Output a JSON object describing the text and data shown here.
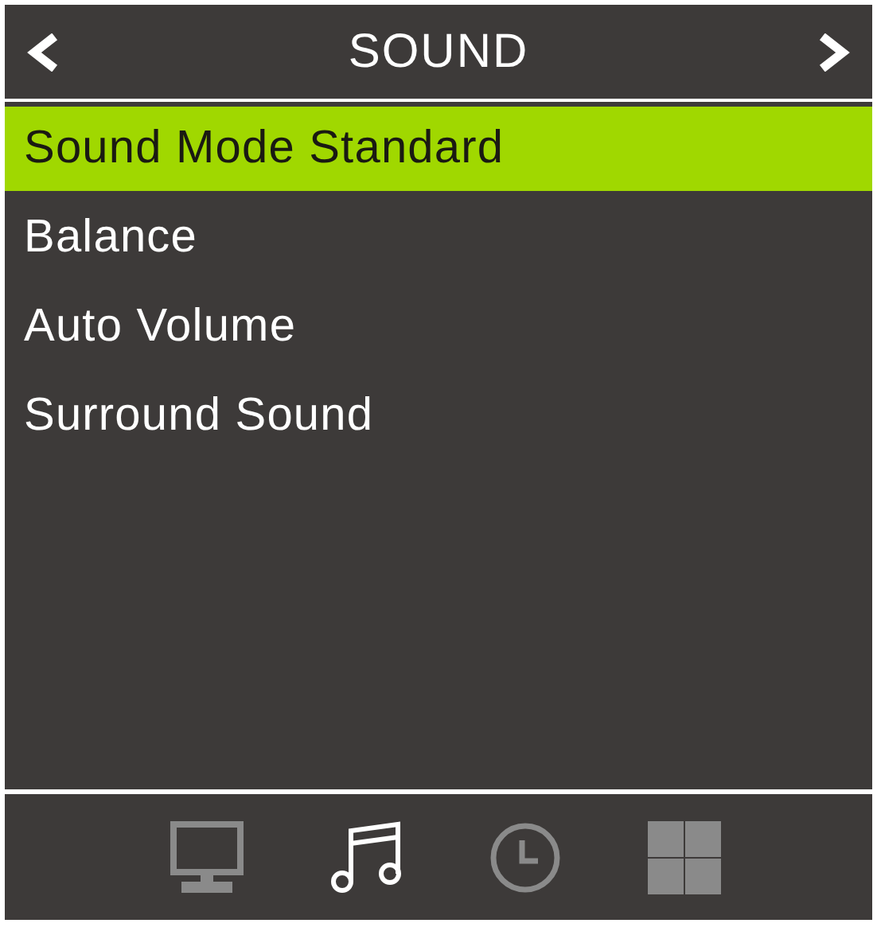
{
  "header": {
    "title": "SOUND"
  },
  "menu": [
    {
      "label": "Sound Mode Standard",
      "selected": true
    },
    {
      "label": "Balance",
      "selected": false
    },
    {
      "label": "Auto Volume",
      "selected": false
    },
    {
      "label": "Surround Sound",
      "selected": false
    }
  ],
  "tabs": [
    {
      "kind": "monitor",
      "selected": false
    },
    {
      "kind": "music",
      "selected": true
    },
    {
      "kind": "clock",
      "selected": false
    },
    {
      "kind": "grid",
      "selected": false
    }
  ]
}
